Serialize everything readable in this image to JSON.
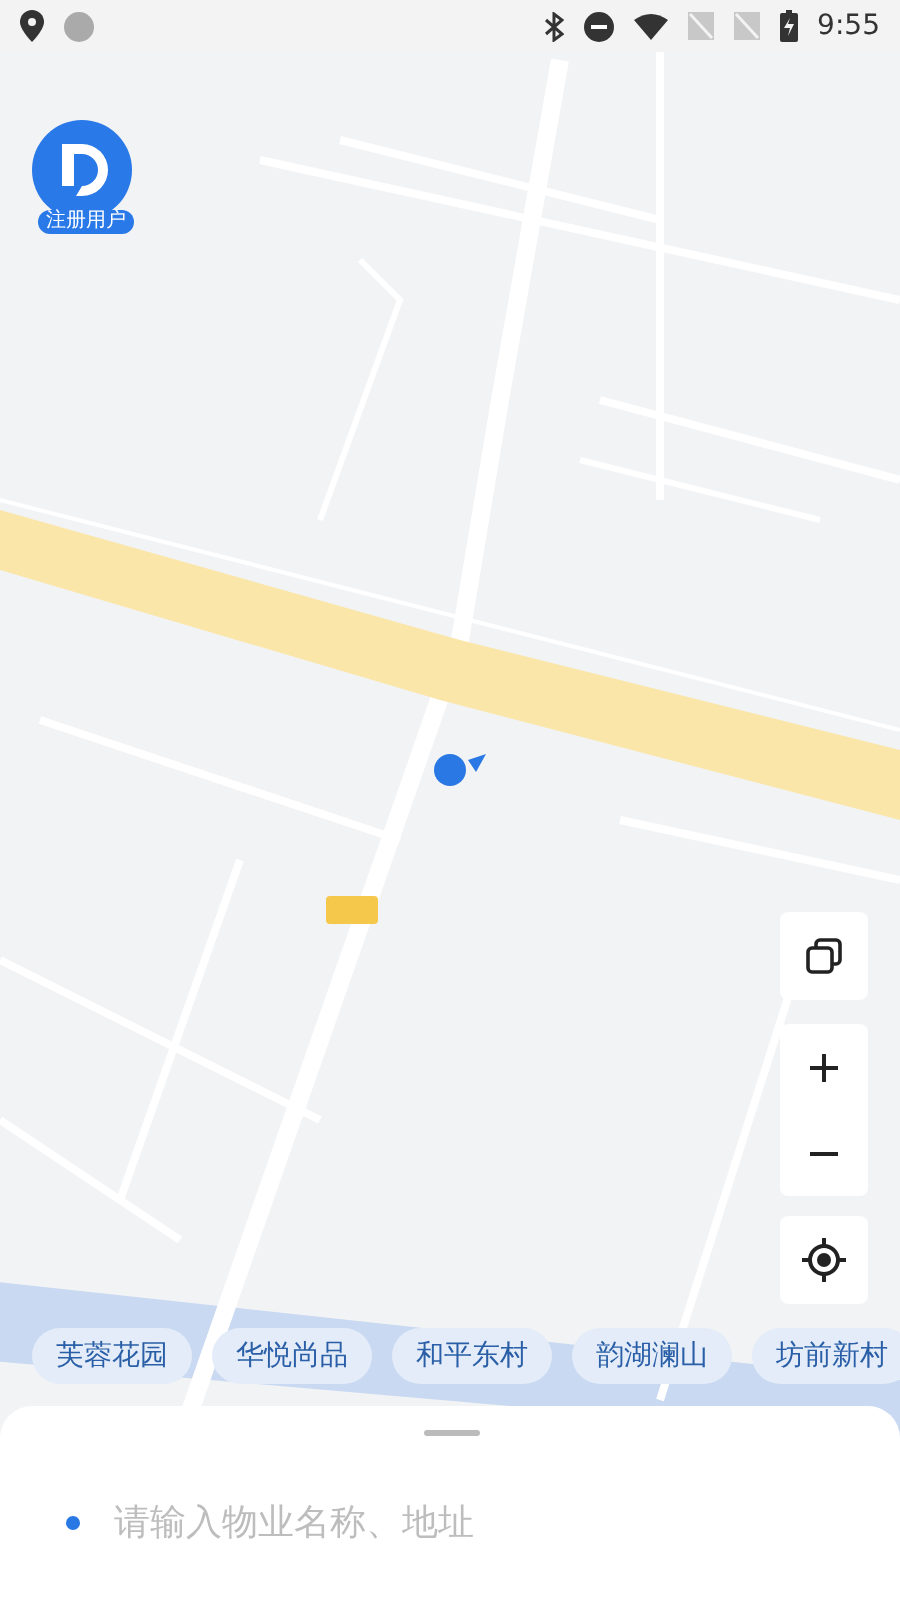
{
  "status_bar": {
    "time": "9:55"
  },
  "user_badge": {
    "label": "注册用户"
  },
  "map_controls": [
    {
      "kind": "layers"
    },
    {
      "kind": "zoom_in"
    },
    {
      "kind": "zoom_out"
    },
    {
      "kind": "locate"
    }
  ],
  "quick_places": [
    "芙蓉花园",
    "华悦尚品",
    "和平东村",
    "韵湖澜山",
    "坊前新村"
  ],
  "search": {
    "placeholder": "请输入物业名称、地址"
  }
}
